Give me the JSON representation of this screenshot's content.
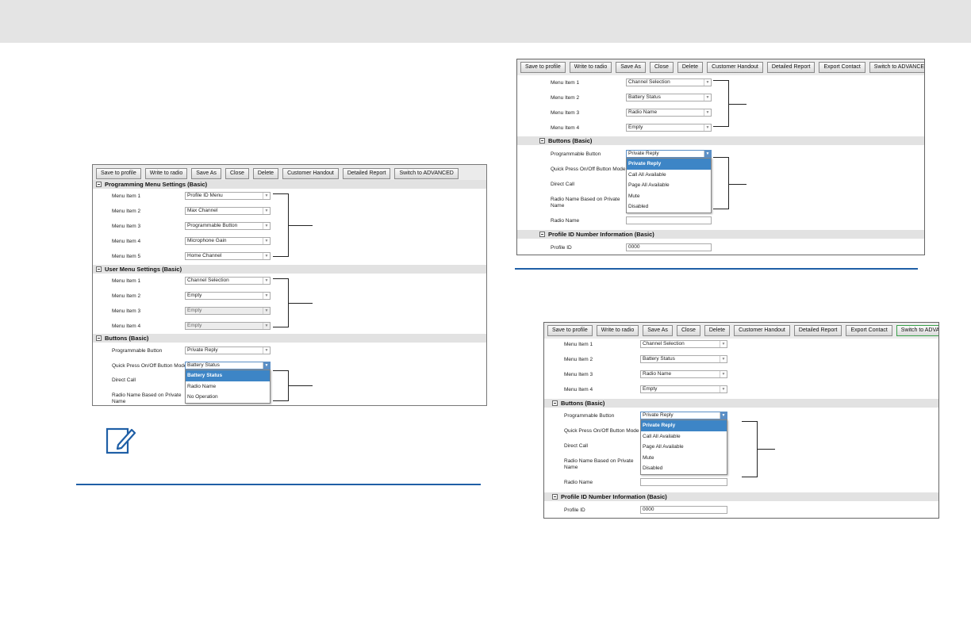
{
  "toolbar_left": [
    "Save to profile",
    "Write to radio",
    "Save As",
    "Close",
    "Delete",
    "Customer Handout",
    "Detailed Report",
    "Switch to ADVANCED"
  ],
  "toolbar_right": [
    "Save to profile",
    "Write to radio",
    "Save As",
    "Close",
    "Delete",
    "Customer Handout",
    "Detailed Report",
    "Export Contact",
    "Switch to ADVANCED"
  ],
  "fig1": {
    "sec_prog": "Programming Menu Settings (Basic)",
    "prog_items": [
      {
        "label": "Menu Item 1",
        "value": "Profile ID Menu"
      },
      {
        "label": "Menu Item 2",
        "value": "Max Channel"
      },
      {
        "label": "Menu Item 3",
        "value": "Programmable Button"
      },
      {
        "label": "Menu Item 4",
        "value": "Microphone Gain"
      },
      {
        "label": "Menu Item 5",
        "value": "Home Channel"
      }
    ],
    "sec_user": "User Menu Settings (Basic)",
    "user_items": [
      {
        "label": "Menu Item 1",
        "value": "Channel Selection"
      },
      {
        "label": "Menu Item 2",
        "value": "Empty"
      },
      {
        "label": "Menu Item 3",
        "value": "Empty"
      },
      {
        "label": "Menu Item 4",
        "value": "Empty"
      }
    ],
    "sec_buttons": "Buttons (Basic)",
    "btn_prog_label": "Programmable Button",
    "btn_prog_value": "Private Reply",
    "quick_label": "Quick Press On/Off Button Mode",
    "quick_value": "Battery Status",
    "direct_label": "Direct Call",
    "radio_name_label": "Radio Name Based on Private Name",
    "dropdown": [
      "Battery Status",
      "Radio Name",
      "No Operation"
    ]
  },
  "fig2": {
    "menu_items": [
      {
        "label": "Menu Item 1",
        "value": "Channel Selection"
      },
      {
        "label": "Menu Item 2",
        "value": "Battery Status"
      },
      {
        "label": "Menu Item 3",
        "value": "Radio Name"
      },
      {
        "label": "Menu Item 4",
        "value": "Empty"
      }
    ],
    "sec_buttons": "Buttons (Basic)",
    "btn_prog_label": "Programmable Button",
    "btn_prog_value": "Private Reply",
    "quick_label": "Quick Press On/Off Button Mode",
    "direct_label": "Direct Call",
    "radio_name_label": "Radio Name Based on Private Name",
    "radio_name_field": "Radio Name",
    "dropdown": [
      "Private Reply",
      "Call All Available",
      "Page All Available",
      "Mute",
      "Disabled"
    ],
    "sec_profile": "Profile ID Number Information (Basic)",
    "profile_label": "Profile ID",
    "profile_value": "0000"
  },
  "fig3": {
    "menu_items": [
      {
        "label": "Menu Item 1",
        "value": "Channel Selection"
      },
      {
        "label": "Menu Item 2",
        "value": "Battery Status"
      },
      {
        "label": "Menu Item 3",
        "value": "Radio Name"
      },
      {
        "label": "Menu Item 4",
        "value": "Empty"
      }
    ],
    "sec_buttons": "Buttons (Basic)",
    "btn_prog_label": "Programmable Button",
    "btn_prog_value": "Private Reply",
    "quick_label": "Quick Press On/Off Button Mode",
    "direct_label": "Direct Call",
    "radio_name_label": "Radio Name Based on Private Name",
    "radio_name_field": "Radio Name",
    "dropdown": [
      "Private Reply",
      "Call All Available",
      "Page All Available",
      "Mute",
      "Disabled"
    ],
    "sec_profile": "Profile ID Number Information (Basic)",
    "profile_label": "Profile ID",
    "profile_value": "0000"
  },
  "colors": {
    "accent": "#1f5fa6",
    "highlight": "#3d85c6",
    "switch_border": "#3aa04a",
    "header_bg": "#e4e4e4"
  },
  "icons": [
    "collapse-icon",
    "dropdown-arrow-icon",
    "note-pencil-icon"
  ]
}
